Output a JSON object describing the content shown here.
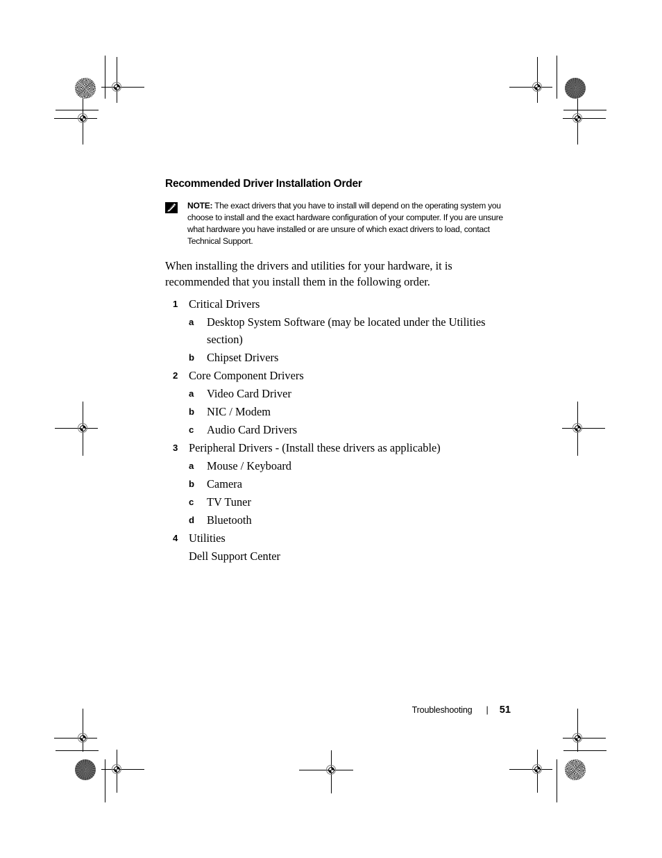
{
  "document": {
    "section_heading": "Recommended Driver Installation Order",
    "note": {
      "icon": "pencil-note-icon",
      "label": "NOTE:",
      "text": " The exact drivers that you have to install will depend on the operating system you choose to install and the exact hardware configuration of your computer. If you are unsure what hardware you have installed or are unsure of which exact drivers to load, contact Technical Support."
    },
    "intro_paragraph": "When installing the drivers and utilities for your hardware, it is recommended that you install them in the following order.",
    "steps": [
      {
        "marker": "1",
        "label": "Critical Drivers",
        "substeps": [
          {
            "marker": "a",
            "label": "Desktop System Software (may be located under the Utilities section)"
          },
          {
            "marker": "b",
            "label": "Chipset Drivers"
          }
        ]
      },
      {
        "marker": "2",
        "label": "Core Component Drivers",
        "substeps": [
          {
            "marker": "a",
            "label": "Video Card Driver"
          },
          {
            "marker": "b",
            "label": "NIC / Modem"
          },
          {
            "marker": "c",
            "label": "Audio Card Drivers"
          }
        ]
      },
      {
        "marker": "3",
        "label": "Peripheral Drivers - (Install these drivers as applicable)",
        "substeps": [
          {
            "marker": "a",
            "label": "Mouse / Keyboard"
          },
          {
            "marker": "b",
            "label": "Camera"
          },
          {
            "marker": "c",
            "label": "TV Tuner"
          },
          {
            "marker": "d",
            "label": "Bluetooth"
          }
        ]
      },
      {
        "marker": "4",
        "label": "Utilities",
        "substeps": [],
        "continuation": "Dell Support Center"
      }
    ]
  },
  "footer": {
    "chapter": "Troubleshooting",
    "separator": "|",
    "page_number": "51"
  },
  "colors": {
    "text": "#000000",
    "page_background": "#ffffff",
    "mark_ring": "#7a7a7a"
  }
}
